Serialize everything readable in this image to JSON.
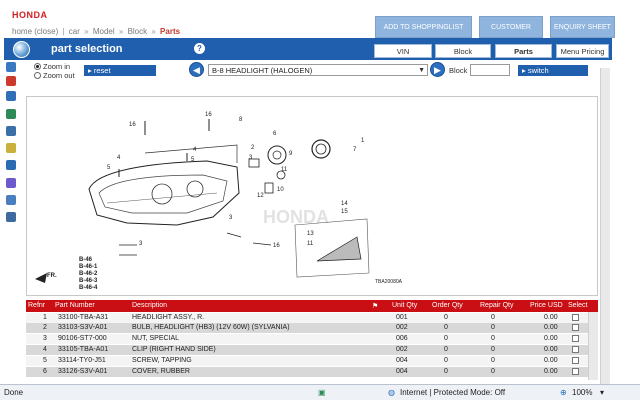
{
  "header": {
    "logo": "HONDA",
    "breadcrumb": {
      "items": [
        "home (close)",
        "car",
        "Model",
        "Block",
        "Parts"
      ],
      "separators": [
        "|",
        "»",
        "»",
        "»"
      ]
    },
    "buttons": {
      "shoppinglist": "ADD TO SHOPPINGLIST",
      "customer": "CUSTOMER",
      "enquiry": "ENQUIRY SHEET"
    }
  },
  "panel": {
    "title": "part selection",
    "help": "?",
    "tabs": [
      "VIN",
      "Block",
      "Parts",
      "Menu Pricing"
    ],
    "active_tab": "Parts"
  },
  "controls": {
    "zoom_in": "Zoom in",
    "zoom_out": "Zoom out",
    "reset": "reset",
    "block_select": "B-8 HEADLIGHT (HALOGEN)",
    "block_label": "Block",
    "block_input": "",
    "switch": "switch"
  },
  "diagram": {
    "callouts": [
      "16",
      "16",
      "8",
      "1",
      "6",
      "7",
      "5",
      "4",
      "4",
      "5",
      "2",
      "3",
      "10",
      "12",
      "11",
      "9",
      "3",
      "16",
      "14",
      "15",
      "13",
      "11",
      "3"
    ],
    "block_refs": [
      "B-46",
      "B-46-1",
      "B-46-2",
      "B-46-3",
      "B-46-4"
    ],
    "fr": "FR.",
    "code": "TBA20080A",
    "watermark": "HONDA"
  },
  "table": {
    "headers": {
      "refnr": "Refnr",
      "part_number": "Part Number",
      "description": "Description",
      "qty": "Unit Qty",
      "order_qty": "Order Qty",
      "repair_qty": "Repair Qty",
      "price": "Price USD",
      "select": "Select"
    },
    "rows": [
      {
        "ref": "1",
        "part": "33100-TBA-A31",
        "desc": "HEADLIGHT ASSY., R.",
        "qty": "001",
        "order": "0",
        "repair": "0",
        "price": "0.00"
      },
      {
        "ref": "2",
        "part": "33103-S3V-A01",
        "desc": "BULB, HEADLIGHT (HB3) (12V 60W) (SYLVANIA)",
        "qty": "002",
        "order": "0",
        "repair": "0",
        "price": "0.00"
      },
      {
        "ref": "3",
        "part": "90106-ST7-000",
        "desc": "NUT, SPECIAL",
        "qty": "006",
        "order": "0",
        "repair": "0",
        "price": "0.00"
      },
      {
        "ref": "4",
        "part": "33105-TBA-A01",
        "desc": "CLIP (RIGHT HAND SIDE)",
        "qty": "002",
        "order": "0",
        "repair": "0",
        "price": "0.00"
      },
      {
        "ref": "5",
        "part": "33114-TY0-J51",
        "desc": "SCREW, TAPPING",
        "qty": "004",
        "order": "0",
        "repair": "0",
        "price": "0.00"
      },
      {
        "ref": "6",
        "part": "33126-S3V-A01",
        "desc": "COVER, RUBBER",
        "qty": "004",
        "order": "0",
        "repair": "0",
        "price": "0.00"
      }
    ]
  },
  "statusbar": {
    "left": "Done",
    "zone": "Internet | Protected Mode: Off",
    "zoom": "100%"
  },
  "colors": {
    "brand_red": "#c90f14",
    "panel_blue": "#1f5fae",
    "button_blue": "#8fb4de"
  }
}
